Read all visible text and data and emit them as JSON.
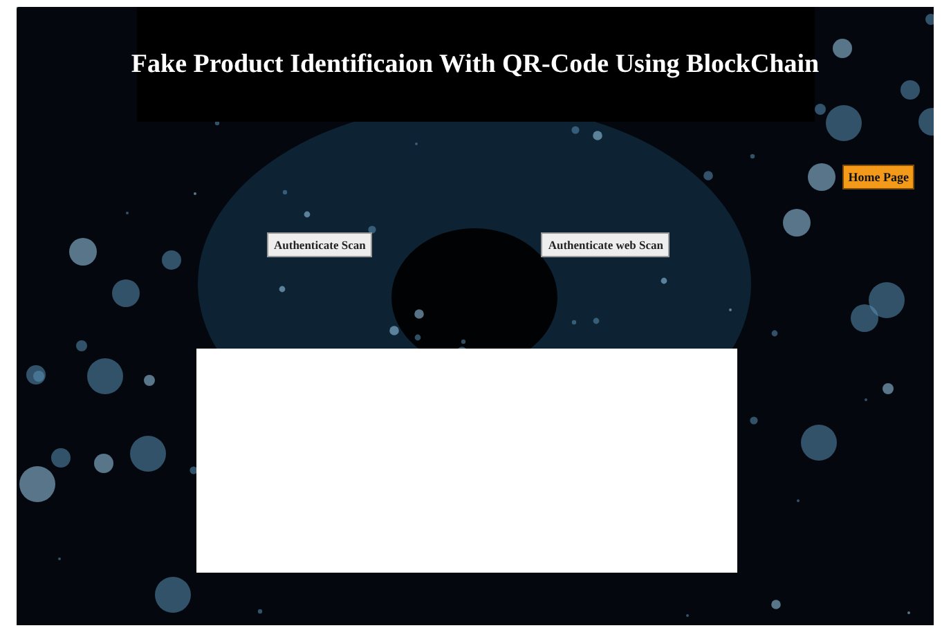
{
  "header": {
    "title": "Fake Product Identificaion With QR-Code Using BlockChain"
  },
  "home_button": {
    "label": "Home Page"
  },
  "scan_buttons": [
    {
      "label": "Authenticate Scan"
    },
    {
      "label": "Authenticate web Scan"
    }
  ],
  "result_panel": {
    "kind": "blank"
  }
}
